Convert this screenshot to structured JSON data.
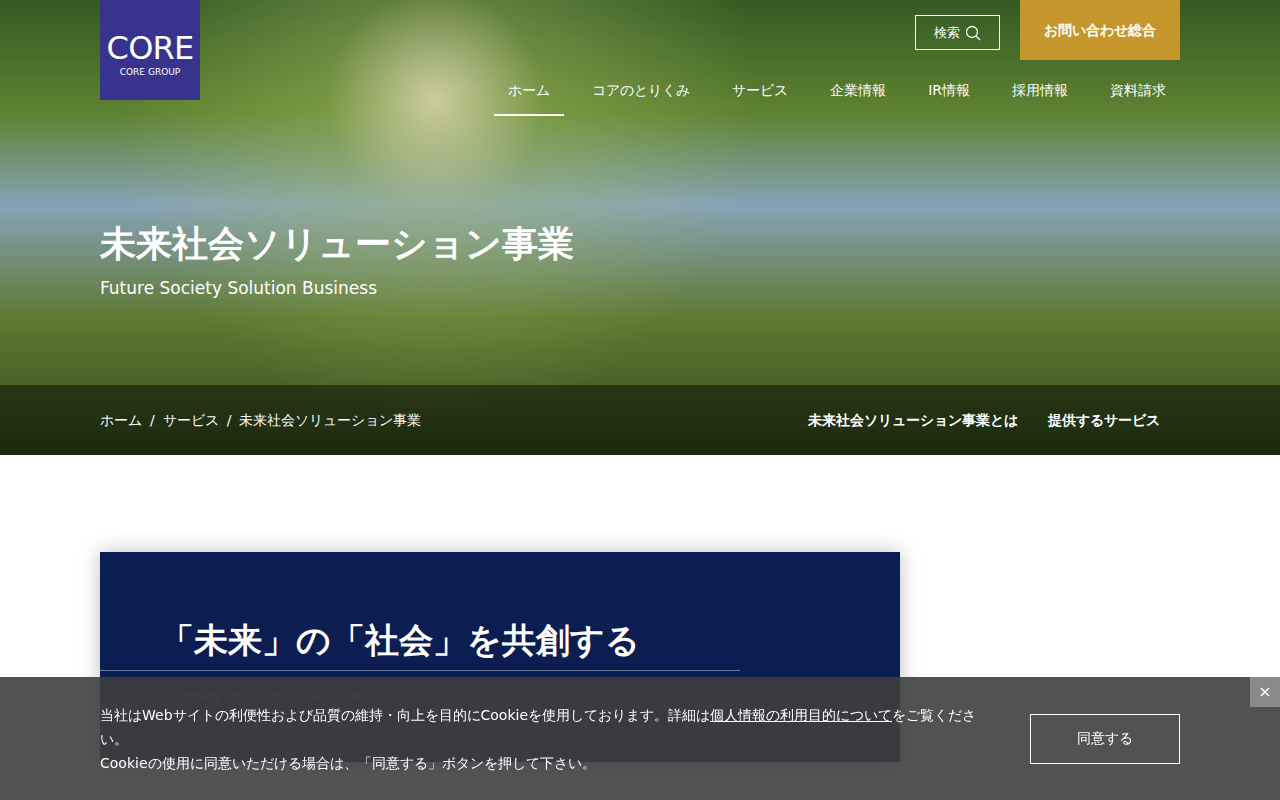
{
  "logo": {
    "title": "CORE",
    "subtitle": "CORE GROUP"
  },
  "search": {
    "label": "検索"
  },
  "contact_button": "お問い合わせ総合",
  "nav": [
    {
      "label": "ホーム",
      "selected": true
    },
    {
      "label": "コアのとりくみ",
      "selected": false
    },
    {
      "label": "サービス",
      "selected": false
    },
    {
      "label": "企業情報",
      "selected": false
    },
    {
      "label": "IR情報",
      "selected": false
    },
    {
      "label": "採用情報",
      "selected": false
    },
    {
      "label": "資料請求",
      "selected": false
    }
  ],
  "hero": {
    "title": "未来社会ソリューション事業",
    "subtitle": "Future Society Solution Business"
  },
  "breadcrumb": {
    "items": [
      "ホーム",
      "サービス",
      "未来社会ソリューション事業"
    ],
    "separator": "/"
  },
  "page_links": [
    "未来社会ソリューション事業とは",
    "提供するサービス"
  ],
  "intro": {
    "heading": "「未来」の「社会」を共創する",
    "subheading": "Co-creating the \"society\" of the \"future\""
  },
  "cookie": {
    "text_before": "当社はWebサイトの利便性および品質の維持・向上を目的にCookieを使用しております。詳細は",
    "link": "個人情報の利用目的について",
    "text_after": "をご覧ください。",
    "line2": "Cookieの使用に同意いただける場合は、「同意する」ボタンを押して下さい。",
    "agree_button": "同意する",
    "close": "×"
  }
}
